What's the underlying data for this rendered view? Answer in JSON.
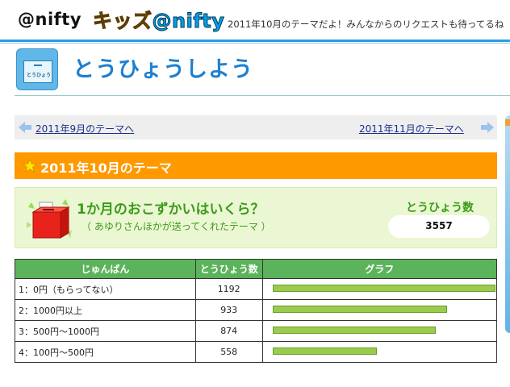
{
  "header": {
    "nifty_logo": "@nifty",
    "kids_logo_part1": "キッズ",
    "kids_logo_part2": "@nifty",
    "message": "2011年10月のテーマだよ！みんなからのリクエストも待ってるね"
  },
  "page": {
    "title": "とうひょうしよう",
    "icon_label": "とうひょう"
  },
  "month_nav": {
    "prev_label": "2011年9月のテーマへ",
    "next_label": "2011年11月のテーマへ"
  },
  "theme": {
    "bar_title": "2011年10月のテーマ",
    "question": "1か月のおこずかいはいくら？",
    "sender": "（ あゆりさんほかが送ってくれたテーマ ）",
    "count_label": "とうひょう数",
    "count_value": "3557"
  },
  "table": {
    "headers": [
      "じゅんばん",
      "とうひょう数",
      "グラフ"
    ],
    "rows": [
      {
        "order": "1：0円（もらってない）",
        "votes": "1192",
        "votes_num": 1192
      },
      {
        "order": "2：1000円以上",
        "votes": "933",
        "votes_num": 933
      },
      {
        "order": "3：500円〜1000円",
        "votes": "874",
        "votes_num": 874
      },
      {
        "order": "4：100円〜500円",
        "votes": "558",
        "votes_num": 558
      }
    ]
  },
  "colors": {
    "accent_blue": "#1e80d0",
    "theme_orange": "#ff9900",
    "theme_green": "#3d9a1a",
    "header_green": "#5bb35b",
    "bar_green": "#99cc4c"
  },
  "icons": [
    "vote-box-icon",
    "arrow-left-icon",
    "arrow-right-icon",
    "star-icon",
    "ballot-box-icon"
  ]
}
